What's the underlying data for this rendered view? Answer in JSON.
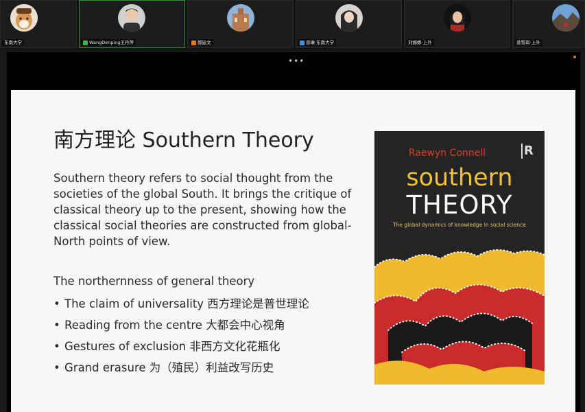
{
  "participants": [
    {
      "name": "东南大学",
      "avatar": "dog-avatar",
      "mic": "muted"
    },
    {
      "name": "WangDenping王丹萍",
      "avatar": "person-avatar",
      "mic": "active"
    },
    {
      "name": "郝延文",
      "avatar": "building-avatar",
      "mic": "muted"
    },
    {
      "name": "曾琳·东南大学",
      "avatar": "person-avatar",
      "mic": "muted"
    },
    {
      "name": "刘娜娜·上外",
      "avatar": "person-avatar",
      "mic": "muted"
    },
    {
      "name": "曾雪琪·上外",
      "avatar": "landscape-avatar",
      "mic": "muted"
    }
  ],
  "share": {
    "menu_dots": "•••"
  },
  "slide": {
    "title": "南方理论 Southern Theory",
    "paragraph": "Southern theory refers to social thought from the societies of the global South. It brings the critique of classical theory up to the present, showing how the classical social theories are constructed from global-North points of view.",
    "subheading": "The northernness of general theory",
    "bullets": [
      "The claim of universality 西方理论是普世理论",
      "Reading from the centre 大都会中心视角",
      "Gestures of exclusion 非西方文化花瓶化",
      "Grand erasure 为（殖民）利益改写历史"
    ],
    "bullet_glyph": "•"
  },
  "book": {
    "author": "Raewyn Connell",
    "publisher_logo": "R",
    "title_line1": "southern",
    "title_line2": "THEORY",
    "tagline": "The global dynamics of knowledge in social science",
    "colors": {
      "bg": "#242424",
      "yellow": "#f1b92c",
      "red": "#c92a2a",
      "black": "#1a1a1a"
    }
  }
}
